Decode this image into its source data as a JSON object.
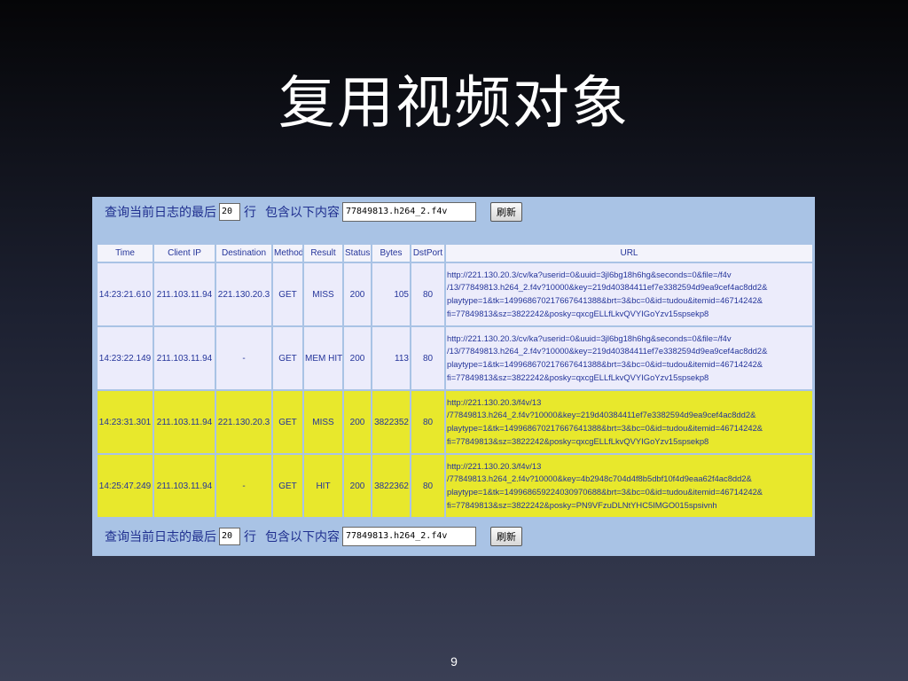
{
  "slide": {
    "title": "复用视频对象",
    "page_number": "9"
  },
  "filter": {
    "prefix_label": "查询当前日志的最后",
    "lines_value": "20",
    "lines_suffix": "行",
    "contains_label": "包含以下内容",
    "keyword_value": "77849813.h264_2.f4v",
    "refresh_label": "刷新"
  },
  "table": {
    "headers": [
      "Time",
      "Client IP",
      "Destination",
      "Method",
      "Result",
      "Status",
      "Bytes",
      "DstPort",
      "URL"
    ],
    "rows": [
      {
        "time": "14:23:21.610",
        "client_ip": "211.103.11.94",
        "destination": "221.130.20.3",
        "method": "GET",
        "result": "MISS",
        "status": "200",
        "bytes": "105",
        "dst_port": "80",
        "url_lines": [
          "http://221.130.20.3/cv/ka?userid=0&uuid=3jl6bg18h6hg&seconds=0&file=/f4v",
          "/13/77849813.h264_2.f4v?10000&key=219d40384411ef7e3382594d9ea9cef4ac8dd2&",
          "playtype=1&tk=149968670217667641388&brt=3&bc=0&id=tudou&itemid=46714242&",
          "fi=77849813&sz=3822242&posky=qxcgELLfLkvQVYIGoYzv15spsekp8"
        ],
        "highlight": false
      },
      {
        "time": "14:23:22.149",
        "client_ip": "211.103.11.94",
        "destination": "-",
        "method": "GET",
        "result": "MEM HIT",
        "status": "200",
        "bytes": "113",
        "dst_port": "80",
        "url_lines": [
          "http://221.130.20.3/cv/ka?userid=0&uuid=3jl6bg18h6hg&seconds=0&file=/f4v",
          "/13/77849813.h264_2.f4v?10000&key=219d40384411ef7e3382594d9ea9cef4ac8dd2&",
          "playtype=1&tk=149968670217667641388&brt=3&bc=0&id=tudou&itemid=46714242&",
          "fi=77849813&sz=3822242&posky=qxcgELLfLkvQVYIGoYzv15spsekp8"
        ],
        "highlight": false
      },
      {
        "time": "14:23:31.301",
        "client_ip": "211.103.11.94",
        "destination": "221.130.20.3",
        "method": "GET",
        "result": "MISS",
        "status": "200",
        "bytes": "3822352",
        "dst_port": "80",
        "url_lines": [
          "http://221.130.20.3/f4v/13",
          "/77849813.h264_2.f4v?10000&key=219d40384411ef7e3382594d9ea9cef4ac8dd2&",
          "playtype=1&tk=149968670217667641388&brt=3&bc=0&id=tudou&itemid=46714242&",
          "fi=77849813&sz=3822242&posky=qxcgELLfLkvQVYIGoYzv15spsekp8"
        ],
        "highlight": true
      },
      {
        "time": "14:25:47.249",
        "client_ip": "211.103.11.94",
        "destination": "-",
        "method": "GET",
        "result": "HIT",
        "status": "200",
        "bytes": "3822362",
        "dst_port": "80",
        "url_lines": [
          "http://221.130.20.3/f4v/13",
          "/77849813.h264_2.f4v?10000&key=4b2948c704d4f8b5dbf10f4d9eaa62f4ac8dd2&",
          "playtype=1&tk=149968659224030970688&brt=3&bc=0&id=tudou&itemid=46714242&",
          "fi=77849813&sz=3822242&posky=PN9VFzuDLNtYHC5IMGO015spsivnh"
        ],
        "highlight": true
      }
    ]
  },
  "colors": {
    "panel_bg": "#a9c3e5",
    "row_normal": "#ececfb",
    "row_highlight": "#e8e82c",
    "text_blue": "#24349a"
  }
}
